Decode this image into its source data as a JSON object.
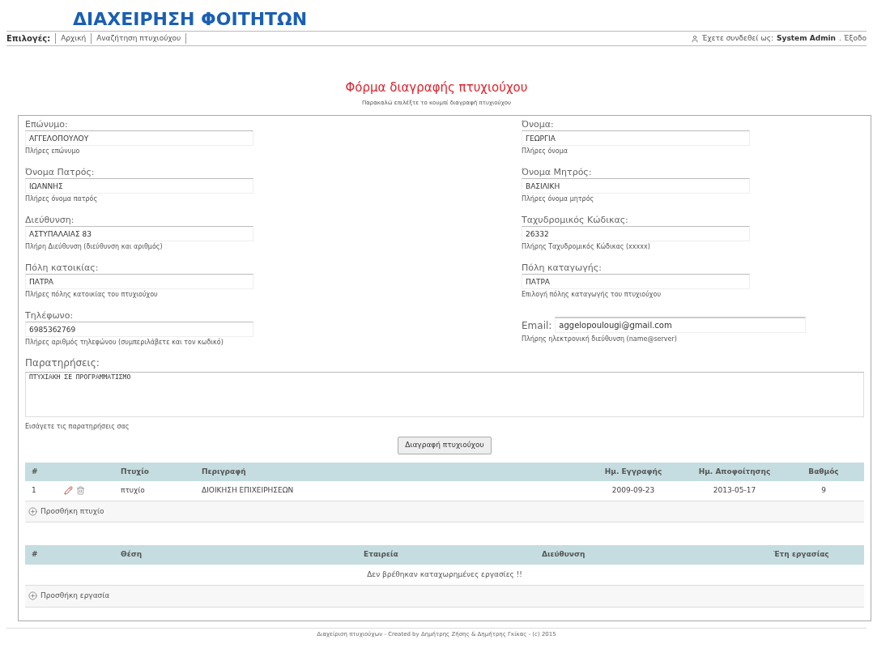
{
  "app_title": "ΔΙΑΧΕΙΡΗΣΗ ΦΟΙΤΗΤΩΝ",
  "nav": {
    "label": "Επιλογές:",
    "links": [
      "Αρχική",
      "Αναζήτηση πτυχιούχου"
    ],
    "login_prefix": "Έχετε συνδεθεί ως:",
    "user": "System Admin",
    "logout": ". Έξοδο"
  },
  "form": {
    "title": "Φόρμα διαγραφής πτυχιούχου",
    "subtitle": "Παρακαλώ επιλέξτε το κουμπί διαγραφή πτυχιούχου",
    "fields": [
      {
        "kind": "stacked",
        "label": "Επώνυμο:",
        "value": "ΑΓΓΕΛΟΠΟΥΛΟΥ",
        "hint": "Πλήρες επώνυμο"
      },
      {
        "kind": "stacked",
        "label": "Όνομα:",
        "value": "ΓΕΩΡΓΙΑ",
        "hint": "Πλήρες όνομα"
      },
      {
        "kind": "stacked",
        "label": "Όνομα Πατρός:",
        "value": "ΙΩΑΝΝΗΣ",
        "hint": "Πλήρες όνομα πατρός"
      },
      {
        "kind": "stacked",
        "label": "Όνομα Μητρός:",
        "value": "ΒΑΣΙΛΙΚΗ",
        "hint": "Πλήρες όνομα μητρός"
      },
      {
        "kind": "stacked",
        "label": "Διεύθυνση:",
        "value": "ΑΣΤΥΠΑΛΑΙΑΣ 83",
        "hint": "Πλήρη Διεύθυνση (διεύθυνση και αριθμός)"
      },
      {
        "kind": "stacked",
        "label": "Ταχυδρομικός Κώδικας:",
        "value": "26332",
        "hint": "Πλήρης Ταχυδρομικός Κώδικας (xxxxx)"
      },
      {
        "kind": "stacked",
        "label": "Πόλη κατοικίας:",
        "value": "ΠΑΤΡΑ",
        "hint": "Πλήρες πόλης κατοικίας του πτυχιούχου"
      },
      {
        "kind": "stacked",
        "label": "Πόλη καταγωγής:",
        "value": "ΠΑΤΡΑ",
        "hint": "Επιλογή πόλης καταγωγής του πτυχιούχου"
      },
      {
        "kind": "stacked",
        "label": "Τηλέφωνο:",
        "value": "6985362769",
        "hint": "Πλήρες αριθμός τηλεφώνου (συμπεριλάβετε και τον κωδικό)"
      },
      {
        "kind": "inline",
        "label": "Email:",
        "value": "aggelopoulougi@gmail.com",
        "hint": "Πλήρης ηλεκτρονική διεύθυνση (name@server)"
      }
    ],
    "remarks": {
      "label": "Παρατηρήσεις:",
      "value": "ΠΤΥΧΙΑΚΗ ΣΕ ΠΡΟΓΡΑΜΜΑΤΙΣΜΟ",
      "hint": "Εισάγετε τις παρατηρήσεις σας"
    },
    "submit": "Διαγραφή πτυχιούχου"
  },
  "tables": [
    {
      "columns": [
        "#",
        "Πτυχίο",
        "Περιγραφή",
        "Ημ. Εγγραφής",
        "Ημ. Αποφοίτησης",
        "Βαθμός"
      ],
      "rows": [
        {
          "cells": [
            "1",
            "πτυχίο",
            "ΔΙΟΙΚΗΣΗ ΕΠΙΧΕΙΡΗΣΕΩΝ",
            "2009-09-23",
            "2013-05-17",
            "9"
          ]
        }
      ],
      "add_link": "Προσθήκη πτυχίο"
    },
    {
      "columns": [
        "#",
        "Θέση",
        "Εταιρεία",
        "Διεύθυνση",
        "Έτη εργασίας"
      ],
      "empty_message": "Δεν βρέθηκαν καταχωρημένες εργασίες !!",
      "add_link": "Προσθήκη εργασία"
    }
  ],
  "footer": "Διαχείριση πτυχιούχων - Created by Δημήτρης Ζήσης & Δημήτρης Γκίκας - (c) 2015"
}
